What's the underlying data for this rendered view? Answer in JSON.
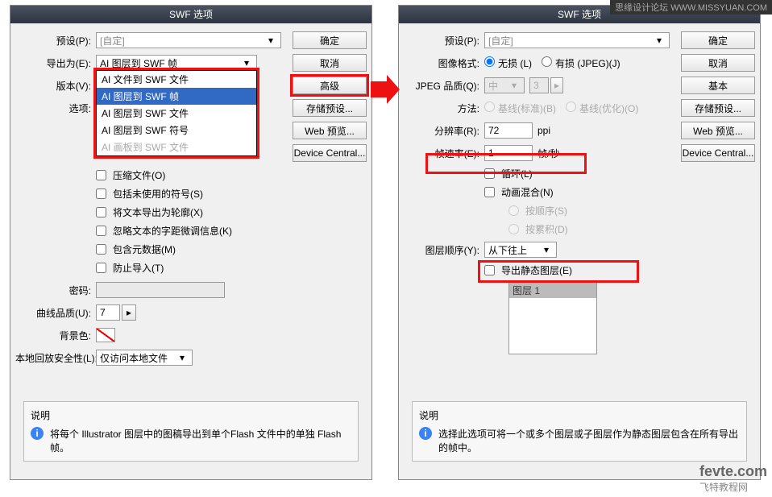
{
  "title": "SWF 选项",
  "wm1": "思缘设计论坛 WWW.MISSYUAN.COM",
  "wm2_brand": "fevte.com",
  "wm2_sub": "飞特教程网",
  "arrow": "→",
  "left": {
    "preset_label": "预设(P):",
    "preset_value": "[自定]",
    "export_label": "导出为(E):",
    "export_value": "AI 图层到 SWF 帧",
    "version_label": "版本(V):",
    "options_label": "选项:",
    "dropdown": {
      "items": [
        "AI 文件到 SWF 文件",
        "AI 图层到 SWF 帧",
        "AI 图层到 SWF 文件",
        "AI 图层到 SWF 符号",
        "AI 画板到 SWF 文件"
      ]
    },
    "checks": {
      "compress": "压缩文件(O)",
      "unused": "包括未使用的符号(S)",
      "outline": "将文本导出为轮廓(X)",
      "kerning": "忽略文本的字距微调信息(K)",
      "metadata": "包含元数据(M)",
      "protect": "防止导入(T)"
    },
    "password_label": "密码:",
    "curve_label": "曲线品质(U):",
    "curve_value": "7",
    "bgcolor_label": "背景色:",
    "security_label": "本地回放安全性(L):",
    "security_value": "仅访问本地文件",
    "desc_title": "说明",
    "desc_text": "将每个 Illustrator 图层中的图稿导出到单个Flash 文件中的单独 Flash 帧。",
    "buttons": {
      "ok": "确定",
      "cancel": "取消",
      "advanced": "高级",
      "save_preset": "存储预设...",
      "web_preview": "Web 预览...",
      "device_central": "Device Central..."
    }
  },
  "right": {
    "preset_label": "预设(P):",
    "preset_value": "[自定]",
    "imgfmt_label": "图像格式:",
    "imgfmt_lossless": "无损 (L)",
    "imgfmt_lossy": "有损 (JPEG)(J)",
    "jpeg_q_label": "JPEG 品质(Q):",
    "jpeg_q_value": "中",
    "jpeg_q_num": "3",
    "method_label": "方法:",
    "method_baseline": "基线(标准)(B)",
    "method_optimized": "基线(优化)(O)",
    "resolution_label": "分辨率(R):",
    "resolution_value": "72",
    "resolution_unit": "ppi",
    "framerate_label": "帧速率(E):",
    "framerate_value": "1",
    "framerate_unit": "帧/秒",
    "loop": "循环(L)",
    "anim_blend": "动画混合(N)",
    "by_order": "按顺序(S)",
    "by_accum": "按累积(D)",
    "layer_order_label": "图层顺序(Y):",
    "layer_order_value": "从下往上",
    "export_static": "导出静态图层(E)",
    "layer_list_item": "图层 1",
    "desc_title": "说明",
    "desc_text": "选择此选项可将一个或多个图层或子图层作为静态图层包含在所有导出的帧中。",
    "buttons": {
      "ok": "确定",
      "cancel": "取消",
      "basic": "基本",
      "save_preset": "存储预设...",
      "web_preview": "Web 预览...",
      "device_central": "Device Central..."
    }
  }
}
